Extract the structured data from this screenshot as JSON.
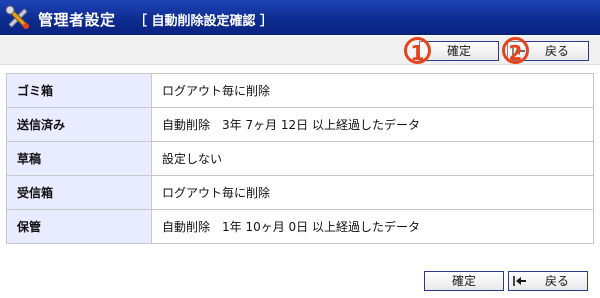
{
  "header": {
    "title": "管理者設定",
    "subtitle": "［ 自動削除設定確認 ］",
    "icon": "tools-icon"
  },
  "toolbar": {
    "confirm_label": "確定",
    "back_label": "戻る",
    "marker_1": "1",
    "marker_2": "2"
  },
  "settings": [
    {
      "label": "ゴミ箱",
      "value": "ログアウト毎に削除"
    },
    {
      "label": "送信済み",
      "value": "自動削除　3年 7ヶ月 12日 以上経過したデータ"
    },
    {
      "label": "草稿",
      "value": "設定しない"
    },
    {
      "label": "受信箱",
      "value": "ログアウト毎に削除"
    },
    {
      "label": "保管",
      "value": "自動削除　1年 10ヶ月 0日 以上経過したデータ"
    }
  ],
  "footer": {
    "confirm_label": "確定",
    "back_label": "戻る"
  },
  "colors": {
    "header_bg": "#0d2a8e",
    "label_bg": "#e9ebff",
    "marker": "#e8441b"
  }
}
